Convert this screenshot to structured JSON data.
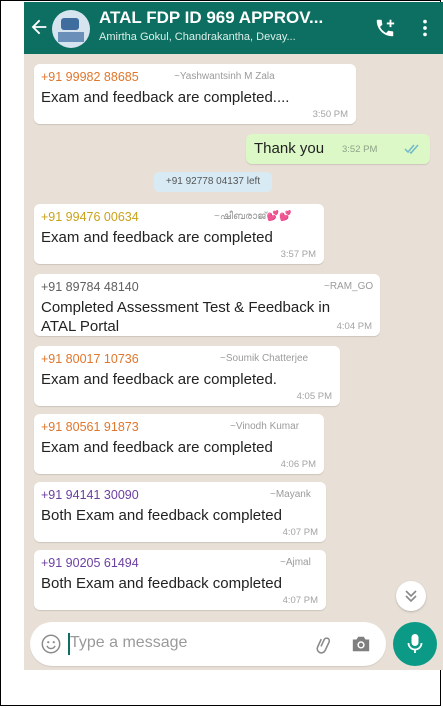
{
  "header": {
    "title": "ATAL FDP ID 969 APPROV...",
    "subtitle": "Amirtha Gokul, Chandrakantha, Devay..."
  },
  "colors": {
    "header": "#0c6f61",
    "chat_bg": "#e8e0d6",
    "outgoing": "#dbf8c6",
    "system": "#d8ebf5",
    "mic": "#0a9a86"
  },
  "messages": [
    {
      "phone": "+91 99982 88685",
      "phone_color": "#e0762b",
      "nick": "~Yashwantsinh M Zala",
      "text": "Exam and feedback are completed....",
      "time": "3:50 PM"
    },
    {
      "outgoing": true,
      "text": "Thank you",
      "time": "3:52 PM"
    },
    {
      "system": true,
      "text": "+91 92778 04137 left"
    },
    {
      "phone": "+91 99476 00634",
      "phone_color": "#c9a21a",
      "nick": "~ഷീബരാജ്💕💕",
      "text": "Exam and feedback are completed",
      "time": "3:57 PM"
    },
    {
      "phone": "+91 89784 48140",
      "phone_color": "#5f5f5f",
      "nick": "~RAM_GO",
      "text": "Completed Assessment Test & Feedback in ATAL Portal",
      "time": "4:04 PM"
    },
    {
      "phone": "+91 80017 10736",
      "phone_color": "#e0762b",
      "nick": "~Soumik Chatterjee",
      "text": "Exam and feedback are completed.",
      "time": "4:05 PM"
    },
    {
      "phone": "+91 80561 91873",
      "phone_color": "#e0762b",
      "nick": "~Vinodh Kumar",
      "text": "Exam and feedback are completed",
      "time": "4:06 PM"
    },
    {
      "phone": "+91 94141 30090",
      "phone_color": "#6b3fa0",
      "nick": "~Mayank",
      "text": "Both Exam and feedback completed",
      "time": "4:07 PM"
    },
    {
      "phone": "+91 90205 61494",
      "phone_color": "#6b3fa0",
      "nick": "~Ajmal",
      "text": "Both Exam and feedback completed",
      "time": "4:07 PM"
    }
  ],
  "composer": {
    "placeholder": "Type a message"
  },
  "icons": {
    "back": "arrow-left-icon",
    "call": "add-call-icon",
    "menu": "more-vert-icon",
    "emoji": "emoji-icon",
    "attach": "paperclip-icon",
    "camera": "camera-icon",
    "mic": "mic-icon",
    "scroll": "chevron-double-down-icon"
  }
}
